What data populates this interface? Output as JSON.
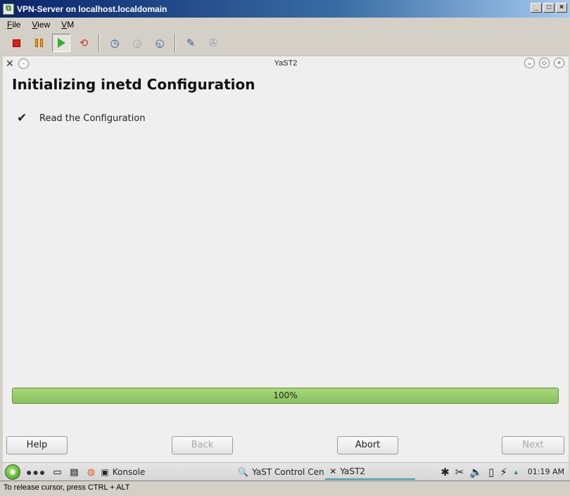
{
  "window": {
    "title": "VPN-Server on localhost.localdomain",
    "controls": [
      "_",
      "□",
      "×"
    ]
  },
  "menu": [
    {
      "label": "File"
    },
    {
      "label": "View"
    },
    {
      "label": "VM"
    }
  ],
  "toolbar": {
    "icons": [
      "power-off-icon",
      "suspend-icon",
      "power-on-icon",
      "reset-icon",
      "snapshot-icon",
      "revert-snapshot-icon",
      "manage-snapshots-icon",
      "edit-settings-icon",
      "tools-icon"
    ]
  },
  "yast": {
    "window_title": "YaST2",
    "heading": "Initializing inetd Configuration",
    "steps": [
      {
        "label": "Read the Configuration",
        "done": true,
        "check": "✔"
      }
    ],
    "progress": {
      "value": 100,
      "label": "100%"
    },
    "buttons": {
      "help": "Help",
      "back": "Back",
      "abort": "Abort",
      "next": "Next"
    }
  },
  "taskbar": {
    "tasks": [
      {
        "label": "Konsole"
      },
      {
        "label": "YaST Control Cen"
      },
      {
        "label": "YaST2"
      }
    ],
    "clock": "01:19 AM"
  },
  "status": {
    "text": "To release cursor, press CTRL + ALT"
  },
  "colors": {
    "title_bar": "#0a246a",
    "progress_fill": "#98cc68",
    "taskbar": "#dcdcdc"
  }
}
